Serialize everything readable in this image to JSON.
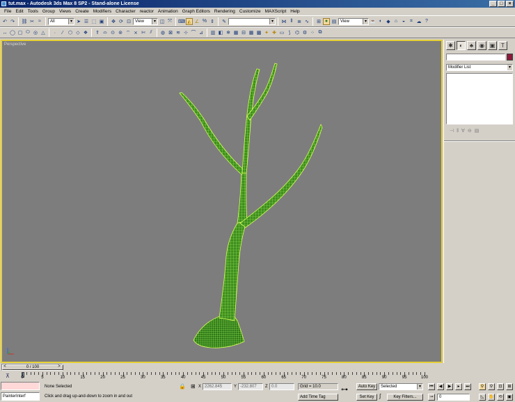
{
  "window": {
    "title": "tut.max - Autodesk 3ds Max 8 SP2 - Stand-alone License",
    "min_label": "_",
    "max_label": "□",
    "close_label": "×"
  },
  "menu": [
    "File",
    "Edit",
    "Tools",
    "Group",
    "Views",
    "Create",
    "Modifiers",
    "Character",
    "reactor",
    "Animation",
    "Graph Editors",
    "Rendering",
    "Customize",
    "MAXScript",
    "Help"
  ],
  "toolbar": {
    "selection_filter": "All",
    "reference_coord": "View",
    "named_selection": "",
    "render_view": "View"
  },
  "viewport": {
    "label": "Perspective"
  },
  "command_panel": {
    "object_name": "",
    "modifier_list": "Modifier List",
    "color": "#8b1a3a"
  },
  "time_slider": {
    "frame": "0 / 100",
    "prev_label": "<",
    "next_label": ">"
  },
  "track_bar": {
    "ticks": [
      "0",
      "5",
      "10",
      "15",
      "20",
      "25",
      "30",
      "35",
      "40",
      "45",
      "50",
      "55",
      "60",
      "65",
      "70",
      "75",
      "80",
      "85",
      "90",
      "95",
      "100"
    ]
  },
  "status": {
    "maxscript_listener": "PainterInterf",
    "selection": "None Selected",
    "prompt": "Click and drag up-and-down to zoom in and out",
    "x_label": "X",
    "x_value": "2262.845",
    "y_label": "Y",
    "y_value": "-232.807",
    "z_label": "Z",
    "z_value": "0.0",
    "grid": "Grid = 10.0",
    "add_time_tag": "Add Time Tag",
    "auto_key": "Auto Key",
    "set_key": "Set Key",
    "key_mode": "Selected",
    "key_filters": "Key Filters...",
    "current_frame": "0"
  }
}
